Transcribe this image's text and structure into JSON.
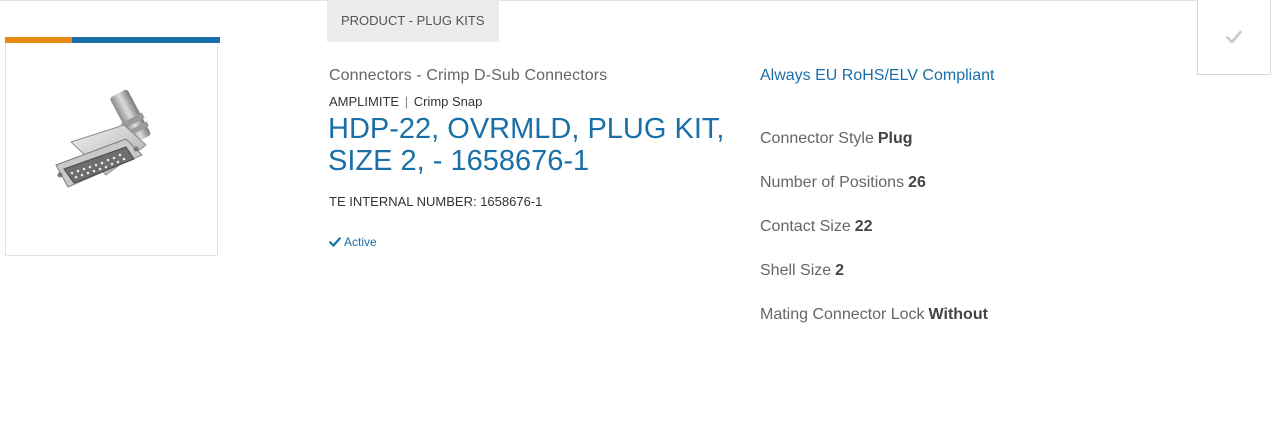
{
  "product": {
    "category_tag": "PRODUCT - PLUG KITS",
    "breadcrumb": "Connectors - Crimp D-Sub Connectors",
    "series_brand": "AMPLIMITE",
    "series_separator": "|",
    "series_name": "Crimp Snap",
    "title": "HDP-22, OVRMLD, PLUG KIT, SIZE 2, - 1658676-1",
    "internal_number": "TE INTERNAL NUMBER: 1658676-1",
    "status": "Active",
    "status_icon": "checkmark-icon",
    "image_alt": "connector-image"
  },
  "compliance": {
    "label": "Always EU RoHS/ELV Compliant"
  },
  "specs": [
    {
      "label": "Connector Style",
      "value": "Plug"
    },
    {
      "label": "Number of Positions",
      "value": "26"
    },
    {
      "label": "Contact Size",
      "value": "22"
    },
    {
      "label": "Shell Size",
      "value": "2"
    },
    {
      "label": "Mating Connector Lock",
      "value": "Without"
    }
  ],
  "compare": {
    "icon": "checkmark-icon",
    "checked": false
  },
  "colors": {
    "brand_blue": "#1a6fa8",
    "accent_orange": "#e88a12",
    "tag_background": "#ececec"
  }
}
